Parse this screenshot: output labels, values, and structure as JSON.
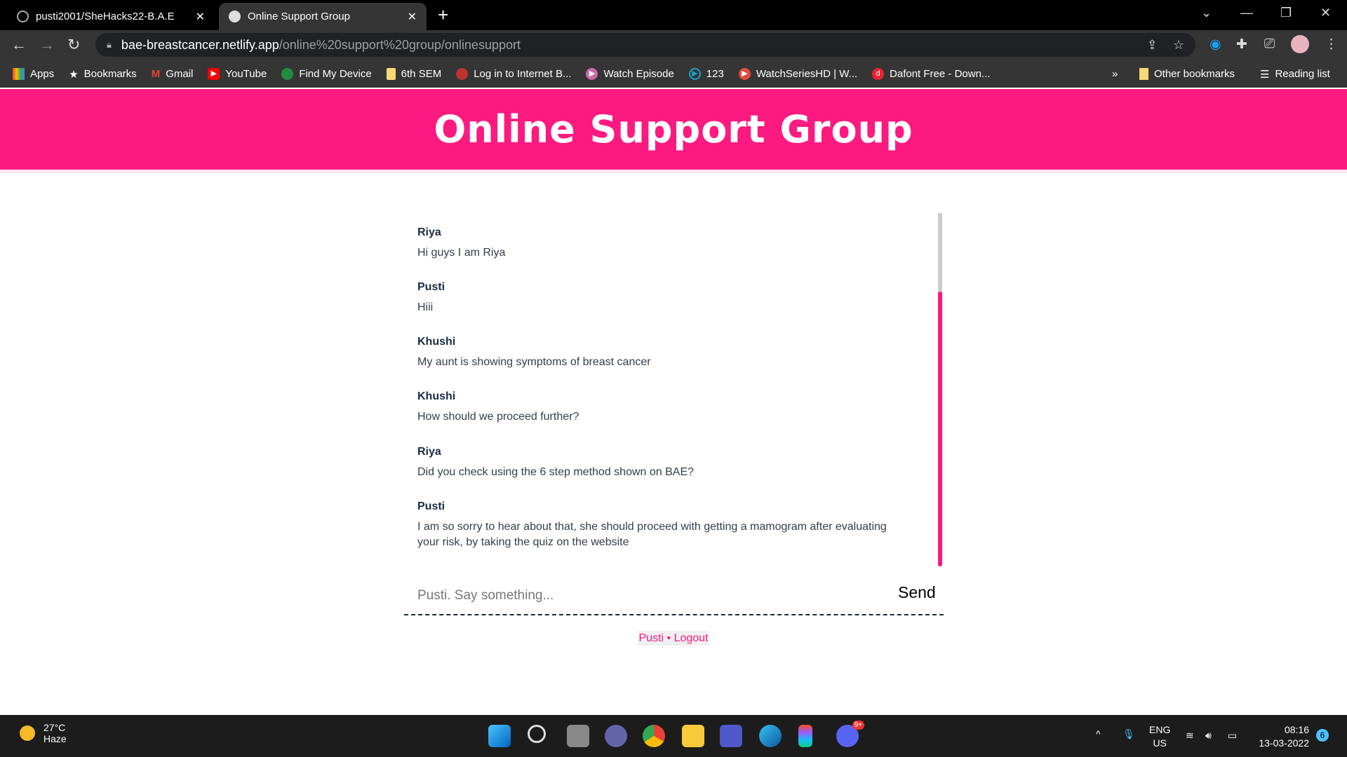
{
  "browser": {
    "tabs": [
      {
        "title": "pusti2001/SheHacks22-B.A.E",
        "active": false
      },
      {
        "title": "Online Support Group",
        "active": true
      }
    ],
    "url_host": "bae-breastcancer.netlify.app",
    "url_path": "/online%20support%20group/onlinesupport",
    "bookmarks": [
      "Apps",
      "Bookmarks",
      "Gmail",
      "YouTube",
      "Find My Device",
      "6th SEM",
      "Log in to Internet B...",
      "Watch Episode",
      "123",
      "WatchSeriesHD | W...",
      "Dafont Free - Down..."
    ],
    "bookmarks_overflow": "»",
    "other_bookmarks": "Other bookmarks",
    "reading_list": "Reading list"
  },
  "page": {
    "title": "Online Support Group",
    "messages": [
      {
        "name": "Riya",
        "text": "Hi guys I am Riya"
      },
      {
        "name": "Pusti",
        "text": "Hiii"
      },
      {
        "name": "Khushi",
        "text": "My aunt is showing symptoms of breast cancer"
      },
      {
        "name": "Khushi",
        "text": "How should we proceed further?"
      },
      {
        "name": "Riya",
        "text": "Did you check using the 6 step method shown on BAE?"
      },
      {
        "name": "Pusti",
        "text": "I am so sorry to hear about that, she should proceed with getting a mamogram after evaluating your risk, by taking the quiz on the website"
      }
    ],
    "input_placeholder": "Pusti. Say something...",
    "send_label": "Send",
    "footer": "Pusti • Logout",
    "scroll_position_fraction": 1.0,
    "accent": "#fc1a80"
  },
  "taskbar": {
    "temp": "27°C",
    "weather": "Haze",
    "lang": "ENG",
    "region": "US",
    "time": "08:16",
    "date": "13-03-2022",
    "notifications": "6",
    "discord_badge": "9+"
  }
}
